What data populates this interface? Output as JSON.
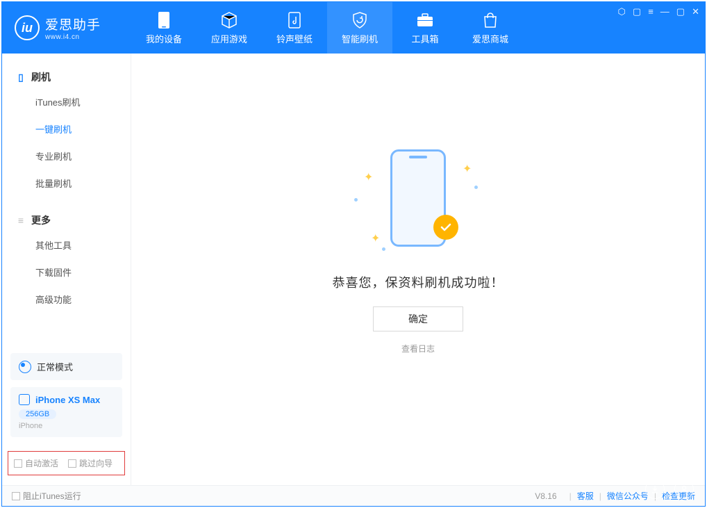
{
  "brand": {
    "title": "爱思助手",
    "subtitle": "www.i4.cn"
  },
  "nav": {
    "items": [
      {
        "label": "我的设备"
      },
      {
        "label": "应用游戏"
      },
      {
        "label": "铃声壁纸"
      },
      {
        "label": "智能刷机"
      },
      {
        "label": "工具箱"
      },
      {
        "label": "爱思商城"
      }
    ],
    "active_index": 3
  },
  "sidebar": {
    "group_flash": "刷机",
    "flash_items": [
      {
        "label": "iTunes刷机"
      },
      {
        "label": "一键刷机"
      },
      {
        "label": "专业刷机"
      },
      {
        "label": "批量刷机"
      }
    ],
    "flash_active_index": 1,
    "group_more": "更多",
    "more_items": [
      {
        "label": "其他工具"
      },
      {
        "label": "下载固件"
      },
      {
        "label": "高级功能"
      }
    ]
  },
  "mode_card": {
    "label": "正常模式"
  },
  "device_card": {
    "name": "iPhone XS Max",
    "capacity": "256GB",
    "type": "iPhone"
  },
  "checkboxes": {
    "auto_activate": "自动激活",
    "skip_guide": "跳过向导"
  },
  "main": {
    "success_message": "恭喜您，保资料刷机成功啦！",
    "confirm_button": "确定",
    "view_log": "查看日志"
  },
  "footer": {
    "block_itunes": "阻止iTunes运行",
    "version": "V8.16",
    "support": "客服",
    "wechat": "微信公众号",
    "check_update": "检查更新"
  }
}
